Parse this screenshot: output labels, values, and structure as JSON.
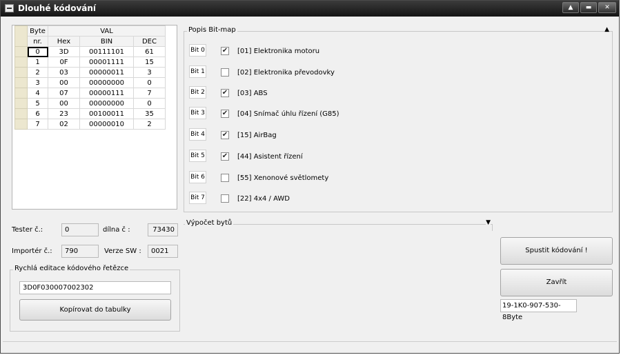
{
  "window": {
    "title": "Dlouhé kódování",
    "controls": {
      "restore": "▲",
      "minimize": "▬",
      "close": "✕"
    }
  },
  "grid": {
    "header_byte": "Byte",
    "header_nr": "nr.",
    "header_val": "VAL",
    "col_hex": "Hex",
    "col_bin": "BIN",
    "col_dec": "DEC",
    "rows": [
      {
        "byte": "0",
        "hex": "3D",
        "bin": "00111101",
        "dec": "61"
      },
      {
        "byte": "1",
        "hex": "0F",
        "bin": "00001111",
        "dec": "15"
      },
      {
        "byte": "2",
        "hex": "03",
        "bin": "00000011",
        "dec": "3"
      },
      {
        "byte": "3",
        "hex": "00",
        "bin": "00000000",
        "dec": "0"
      },
      {
        "byte": "4",
        "hex": "07",
        "bin": "00000111",
        "dec": "7"
      },
      {
        "byte": "5",
        "hex": "00",
        "bin": "00000000",
        "dec": "0"
      },
      {
        "byte": "6",
        "hex": "23",
        "bin": "00100011",
        "dec": "35"
      },
      {
        "byte": "7",
        "hex": "02",
        "bin": "00000010",
        "dec": "2"
      }
    ]
  },
  "bitmap": {
    "title": "Popis Bit-map",
    "collapse_icon": "▲",
    "bits": [
      {
        "label": "Bit 0",
        "checked": true,
        "text": "[01] Elektronika motoru"
      },
      {
        "label": "Bit 1",
        "checked": false,
        "text": "[02] Elektronika převodovky"
      },
      {
        "label": "Bit 2",
        "checked": true,
        "text": "[03] ABS"
      },
      {
        "label": "Bit 3",
        "checked": true,
        "text": "[04] Snímač úhlu řízení (G85)"
      },
      {
        "label": "Bit 4",
        "checked": true,
        "text": "[15] AirBag"
      },
      {
        "label": "Bit 5",
        "checked": true,
        "text": "[44] Asistent řízení"
      },
      {
        "label": "Bit 6",
        "checked": false,
        "text": "[55] Xenonové světlomety"
      },
      {
        "label": "Bit 7",
        "checked": false,
        "text": "[22]  4x4 / AWD"
      }
    ]
  },
  "calc": {
    "title": "Výpočet bytů",
    "expand_icon": "▼"
  },
  "fields": {
    "tester_label": "Tester č.:",
    "tester_value": "0",
    "dilna_label": "dílna č :",
    "dilna_value": "73430",
    "importer_label": "Importér č.:",
    "importer_value": "790",
    "verze_label": "Verze SW :",
    "verze_value": "0021"
  },
  "quick_edit": {
    "title": "Rychlá editace kódového řetězce",
    "value": "3D0F030007002302",
    "copy_button": "Kopírovat do tabulky"
  },
  "actions": {
    "run_button": "Spustit kódování !",
    "close_button": "Zavřít",
    "part_number": "19-1K0-907-530-8Byte"
  }
}
